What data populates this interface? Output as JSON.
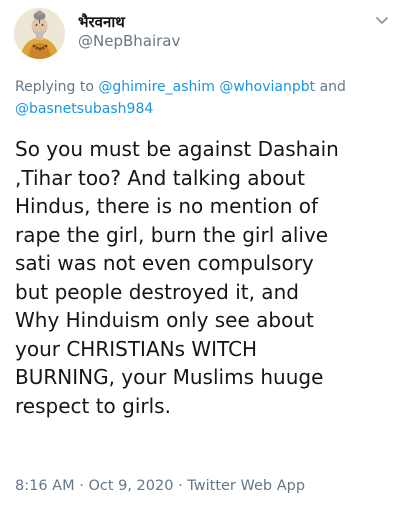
{
  "user": {
    "display_name": "भैरवनाथ",
    "handle": "@NepBhairav",
    "avatar": "avatar-illustration"
  },
  "reply": {
    "prefix": "Replying to",
    "mention_1": "@ghimire_ashim",
    "mention_2": "@whovianpbt",
    "conj": "and",
    "mention_3": "@basnetsubash984"
  },
  "tweet": {
    "lines": [
      "So you must be against Dashain",
      ",Tihar too? And talking about",
      "Hindus, there is no mention of",
      "rape the girl, burn the girl alive",
      "sati was not even compulsory",
      "but people destroyed it, and",
      "Why Hinduism only see about",
      "your CHRISTIANs WITCH",
      "BURNING, your Muslims huuge",
      "respect to girls."
    ]
  },
  "meta": {
    "time": "8:16 AM",
    "sep1": "·",
    "date": "Oct 9, 2020",
    "sep2": "·",
    "source": "Twitter Web App"
  },
  "icons": {
    "menu": "chevron-down-icon"
  },
  "colors": {
    "text": "#14171a",
    "secondary": "#657786",
    "link": "#1b95e0"
  }
}
